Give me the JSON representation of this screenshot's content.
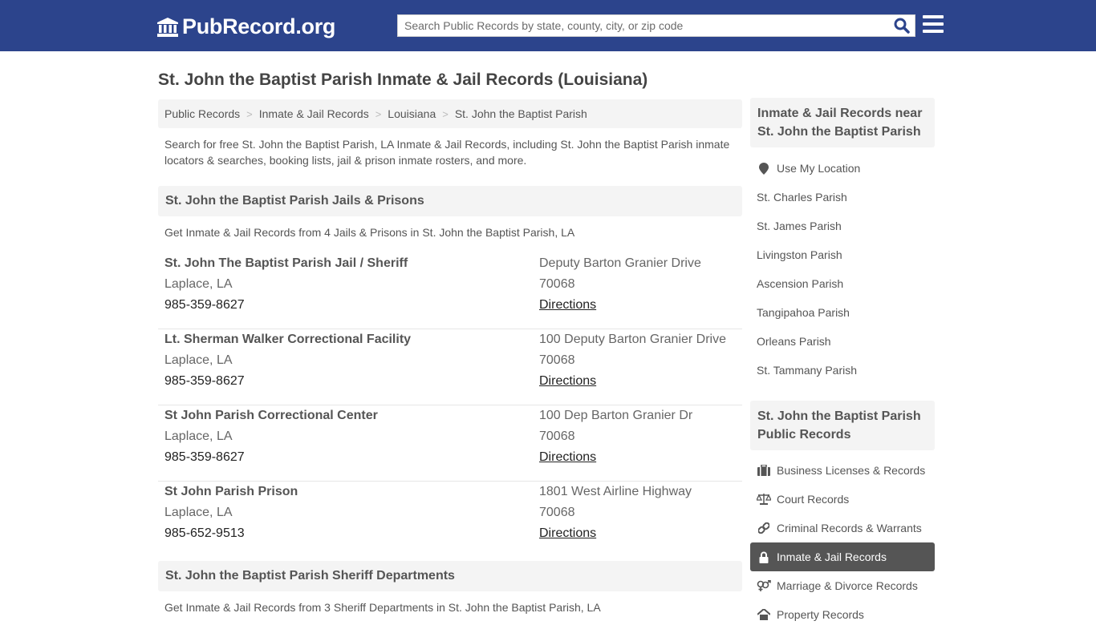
{
  "header": {
    "logo_text": "PubRecord.org",
    "search_placeholder": "Search Public Records by state, county, city, or zip code",
    "brand_color": "#2c448c"
  },
  "page_title": "St. John the Baptist Parish Inmate & Jail Records (Louisiana)",
  "breadcrumb": [
    "Public Records",
    "Inmate & Jail Records",
    "Louisiana",
    "St. John the Baptist Parish"
  ],
  "intro": "Search for free St. John the Baptist Parish, LA Inmate & Jail Records, including St. John the Baptist Parish inmate locators & searches, booking lists, jail & prison inmate rosters, and more.",
  "jails_section": {
    "title": "St. John the Baptist Parish Jails & Prisons",
    "subtitle": "Get Inmate & Jail Records from 4 Jails & Prisons in St. John the Baptist Parish, LA",
    "facilities": [
      {
        "name": "St. John The Baptist Parish Jail / Sheriff",
        "city": "Laplace, LA",
        "phone": "985-359-8627",
        "address": "Deputy Barton Granier Drive",
        "zip": "70068",
        "directions": "Directions"
      },
      {
        "name": "Lt. Sherman Walker Correctional Facility",
        "city": "Laplace, LA",
        "phone": "985-359-8627",
        "address": "100 Deputy Barton Granier Drive",
        "zip": "70068",
        "directions": "Directions"
      },
      {
        "name": "St John Parish Correctional Center",
        "city": "Laplace, LA",
        "phone": "985-359-8627",
        "address": "100 Dep Barton Granier Dr",
        "zip": "70068",
        "directions": "Directions"
      },
      {
        "name": "St John Parish Prison",
        "city": "Laplace, LA",
        "phone": "985-652-9513",
        "address": "1801 West Airline Highway",
        "zip": "70068",
        "directions": "Directions"
      }
    ]
  },
  "sheriff_section": {
    "title": "St. John the Baptist Parish Sheriff Departments",
    "subtitle": "Get Inmate & Jail Records from 3 Sheriff Departments in St. John the Baptist Parish, LA"
  },
  "sidebar": {
    "nearby_title": "Inmate & Jail Records near St. John the Baptist Parish",
    "use_location": "Use My Location",
    "nearby": [
      "St. Charles Parish",
      "St. James Parish",
      "Livingston Parish",
      "Ascension Parish",
      "Tangipahoa Parish",
      "Orleans Parish",
      "St. Tammany Parish"
    ],
    "records_title": "St. John the Baptist Parish Public Records",
    "records": [
      {
        "label": "Business Licenses & Records",
        "icon": "briefcase-icon"
      },
      {
        "label": "Court Records",
        "icon": "scale-icon"
      },
      {
        "label": "Criminal Records & Warrants",
        "icon": "link-icon"
      },
      {
        "label": "Inmate & Jail Records",
        "icon": "lock-icon",
        "active": true
      },
      {
        "label": "Marriage & Divorce Records",
        "icon": "venus-mars-icon"
      },
      {
        "label": "Property Records",
        "icon": "home-icon"
      }
    ]
  }
}
